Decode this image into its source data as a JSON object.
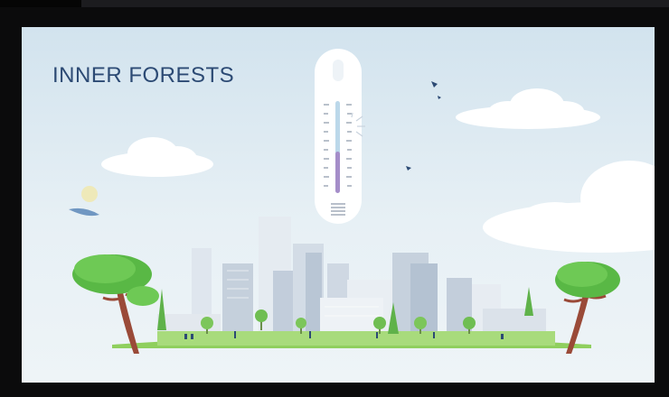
{
  "video": {
    "title": "INNER FORESTS"
  },
  "colors": {
    "sky_top": "#d2e3ee",
    "title": "#2c4a74",
    "thermometer_fill": "#a58ec9",
    "thermometer_upper": "#bcd8ea",
    "grass": "#8fcf5e",
    "tree_canopy": "#59b845",
    "tree_trunk": "#9a4a38"
  },
  "icons": [
    "thermometer-icon",
    "bird-icon",
    "sun-icon",
    "cloud-icon",
    "tree-icon",
    "building-icon"
  ]
}
